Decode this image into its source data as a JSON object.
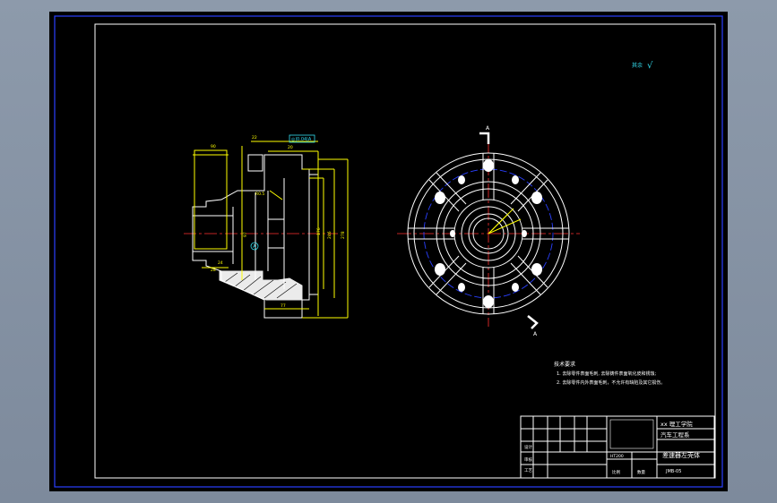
{
  "surface_roughness": {
    "note_text": "其余",
    "symbol": "√"
  },
  "left_view": {
    "tolerance_frame": "◎|0.04|A",
    "dims": [
      "90",
      "22",
      "20",
      "97",
      "R0.5",
      "24",
      "176",
      "246",
      "268",
      "278",
      "254",
      "77",
      "28"
    ],
    "datum": "A"
  },
  "right_view": {
    "section_mark_top": "A",
    "section_mark_bottom": "A"
  },
  "tech_requirements": {
    "title": "技术要求",
    "lines": [
      "1. 去除零件表面毛刺, 去除铸件表面氧化皮和锈蚀;",
      "2. 去除零件内外表面毛刺，不允许有缺陷及其它损伤。"
    ]
  },
  "title_block": {
    "school": "xx 理工学院",
    "department": "汽车工程系",
    "part_name": "差速器左壳体",
    "material": "HT200",
    "drawing_no": "JMB-05",
    "labels": [
      "设计",
      "审核",
      "工艺",
      "批准"
    ],
    "scale_labels": [
      "比例",
      "数量"
    ]
  },
  "colors": {
    "background": "#000000",
    "frame": "#1a1aff",
    "geometry": "#ffffff",
    "dimensions": "#ffff00",
    "centerline": "#ff3030",
    "annotation": "#33ddee"
  }
}
